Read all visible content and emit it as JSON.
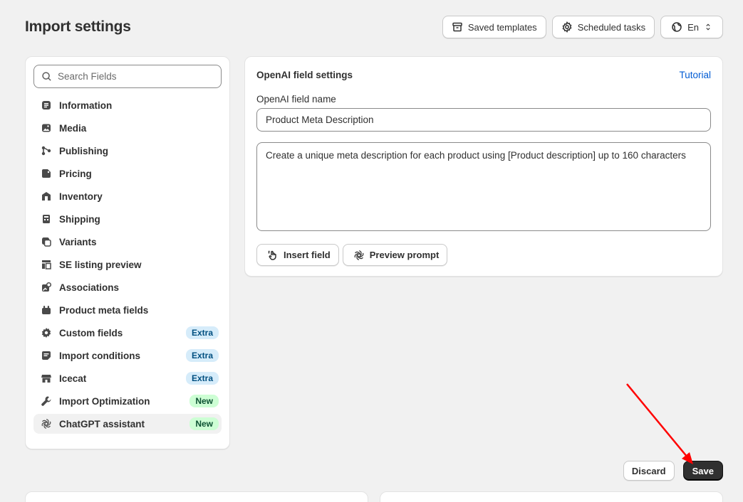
{
  "page": {
    "title": "Import settings"
  },
  "top_actions": {
    "saved_templates": "Saved templates",
    "scheduled_tasks": "Scheduled tasks",
    "language": "En"
  },
  "sidebar": {
    "search_placeholder": "Search Fields",
    "items": [
      {
        "label": "Information",
        "icon": "information-icon",
        "badge": ""
      },
      {
        "label": "Media",
        "icon": "media-icon",
        "badge": ""
      },
      {
        "label": "Publishing",
        "icon": "publishing-icon",
        "badge": ""
      },
      {
        "label": "Pricing",
        "icon": "pricing-icon",
        "badge": ""
      },
      {
        "label": "Inventory",
        "icon": "inventory-icon",
        "badge": ""
      },
      {
        "label": "Shipping",
        "icon": "shipping-icon",
        "badge": ""
      },
      {
        "label": "Variants",
        "icon": "variants-icon",
        "badge": ""
      },
      {
        "label": "SE listing preview",
        "icon": "se-listing-icon",
        "badge": ""
      },
      {
        "label": "Associations",
        "icon": "associations-icon",
        "badge": ""
      },
      {
        "label": "Product meta fields",
        "icon": "meta-fields-icon",
        "badge": ""
      },
      {
        "label": "Custom fields",
        "icon": "gear-icon",
        "badge": "Extra"
      },
      {
        "label": "Import conditions",
        "icon": "conditions-icon",
        "badge": "Extra"
      },
      {
        "label": "Icecat",
        "icon": "store-icon",
        "badge": "Extra"
      },
      {
        "label": "Import Optimization",
        "icon": "wrench-icon",
        "badge": "New"
      },
      {
        "label": "ChatGPT assistant",
        "icon": "openai-icon",
        "badge": "New"
      }
    ]
  },
  "settings": {
    "title": "OpenAI field settings",
    "tutorial_link": "Tutorial",
    "field_name_label": "OpenAI field name",
    "field_name_value": "Product Meta Description",
    "prompt_value": "Create a unique meta description for each product using [Product description] up to 160 characters",
    "insert_field": "Insert field",
    "preview_prompt": "Preview prompt"
  },
  "footer": {
    "discard": "Discard",
    "save": "Save"
  },
  "colors": {
    "background": "#f1f1f1",
    "link": "#005bd3",
    "badge_extra": "#d6ecfa",
    "badge_new": "#cdfed4",
    "save_button": "#303030",
    "annotation_arrow": "#ff0000"
  }
}
